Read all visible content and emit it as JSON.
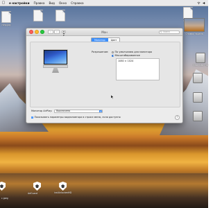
{
  "menubar": {
    "apple_icon": "apple-logo-icon",
    "items": [
      {
        "label": "е настройки",
        "bold": true
      },
      {
        "label": "Правка"
      },
      {
        "label": "Вид"
      },
      {
        "label": "Окно"
      },
      {
        "label": "Справка"
      }
    ],
    "right_icons": [
      "wifi-icon",
      "volume-icon"
    ]
  },
  "desktop": {
    "icons": [
      {
        "label": "ning.jpg",
        "kind": "document"
      },
      {
        "label": "",
        "kind": "document"
      },
      {
        "label": "",
        "kind": "document"
      },
      {
        "label": "ning.jpg",
        "kind": "document"
      },
      {
        "label": "Снимок экрана",
        "kind": "screenshot"
      },
      {
        "label": "Macintosh HD",
        "kind": "disk"
      },
      {
        "label": "",
        "kind": "disk"
      },
      {
        "label": "",
        "kind": "disk"
      },
      {
        "label": "",
        "kind": "disk"
      },
      {
        "label": "",
        "kind": "shield"
      },
      {
        "label": "",
        "kind": "shield"
      },
      {
        "label": "AdGuard",
        "kind": "shield"
      },
      {
        "label": "instUnlockedHD",
        "kind": "shield"
      },
      {
        "label": "c.jpeg",
        "kind": "document"
      }
    ]
  },
  "window": {
    "title": "Мон",
    "search_placeholder": "Поиск",
    "tabs": [
      {
        "label": "Монитор",
        "active": true
      },
      {
        "label": "Цвет",
        "active": false
      }
    ],
    "resolution_label": "Разрешение:",
    "options": [
      {
        "label": "По умолчанию для монитора",
        "selected": false
      },
      {
        "label": "Масштабированное",
        "selected": true
      }
    ],
    "resolutions": [
      "1080 × 1024"
    ],
    "airplay_label": "Монитор AirPlay:",
    "airplay_value": "Выключено",
    "show_mirroring_label": "Показывать параметры видеоповтора в строке меню, если доступно",
    "show_mirroring_checked": true,
    "help_label": "?"
  },
  "colors": {
    "accent": "#3b8efb",
    "close": "#fc5f57",
    "minimize": "#fdbc2e",
    "zoom": "#28c840"
  }
}
